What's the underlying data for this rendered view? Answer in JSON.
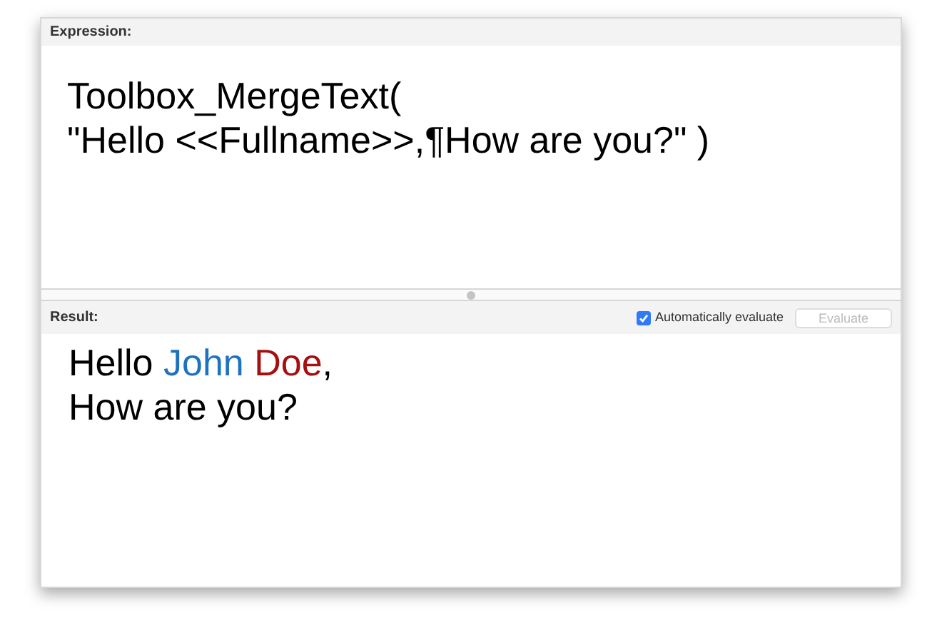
{
  "expression": {
    "label": "Expression:",
    "lines": [
      "Toolbox_MergeText(",
      "\"Hello <<Fullname>>,¶How are you?\" )"
    ]
  },
  "result": {
    "label": "Result:",
    "auto_evaluate": {
      "label": "Automatically evaluate",
      "checked": true
    },
    "evaluate_button": {
      "label": "Evaluate",
      "disabled": true
    },
    "lines": [
      [
        {
          "text": "Hello "
        },
        {
          "text": "John",
          "color": "#1f72bf"
        },
        {
          "text": " Doe",
          "color": "#a50f0f"
        },
        {
          "text": ","
        }
      ],
      [
        {
          "text": "How are you?"
        }
      ]
    ]
  }
}
